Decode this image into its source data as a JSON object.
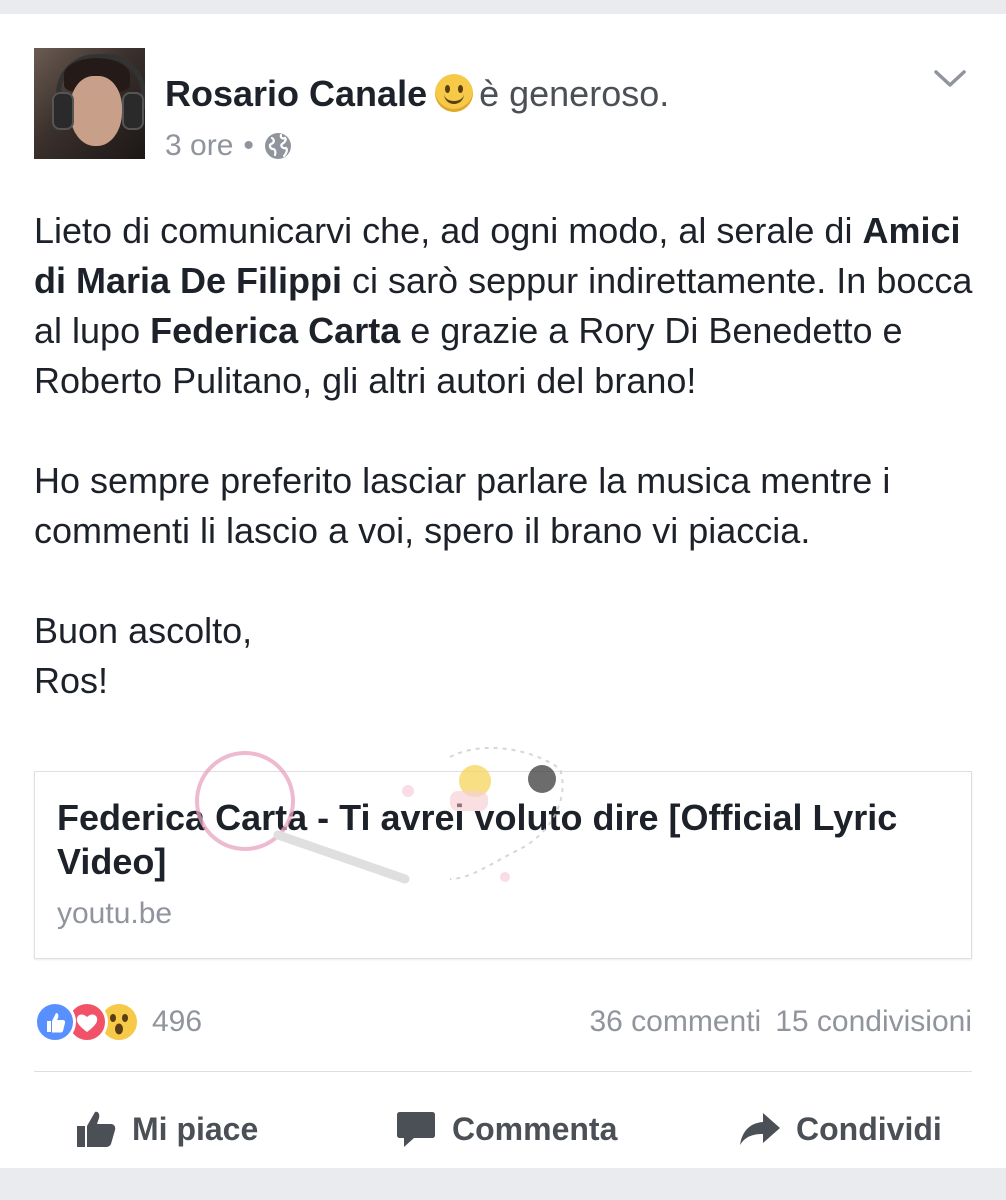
{
  "post": {
    "author": "Rosario Canale",
    "feeling": "è generoso.",
    "time": "3 ore",
    "separator": "•",
    "privacy_icon": "globe-icon",
    "text": {
      "p1_a": "Lieto di comunicarvi che, ad ogni modo, al serale di ",
      "p1_bold1": "Amici di Maria De Filippi",
      "p1_b": " ci sarò seppur indirettamente. In bocca al lupo ",
      "p1_bold2": "Federica Carta",
      "p1_c": " e grazie a Rory Di Benedetto e Roberto Pulitano, gli altri autori del brano!",
      "p2": "Ho sempre preferito lasciar parlare la musica mentre i commenti li lascio a voi, spero il brano vi piaccia.",
      "p3_line1": "Buon ascolto,",
      "p3_line2": "Ros!"
    }
  },
  "link_preview": {
    "title": "Federica Carta - Ti avrei voluto dire [Official Lyric Video]",
    "domain": "youtu.be"
  },
  "stats": {
    "reactions": [
      "like",
      "love",
      "wow"
    ],
    "reaction_count": "496",
    "comments": "36 commenti",
    "shares": "15 condivisioni"
  },
  "actions": {
    "like": "Mi piace",
    "comment": "Commenta",
    "share": "Condividi"
  },
  "colors": {
    "like_blue": "#5890ff",
    "love_red": "#f25268",
    "wow_yellow": "#f7c948",
    "meta_gray": "#90949c",
    "action_gray": "#4b4f56"
  }
}
